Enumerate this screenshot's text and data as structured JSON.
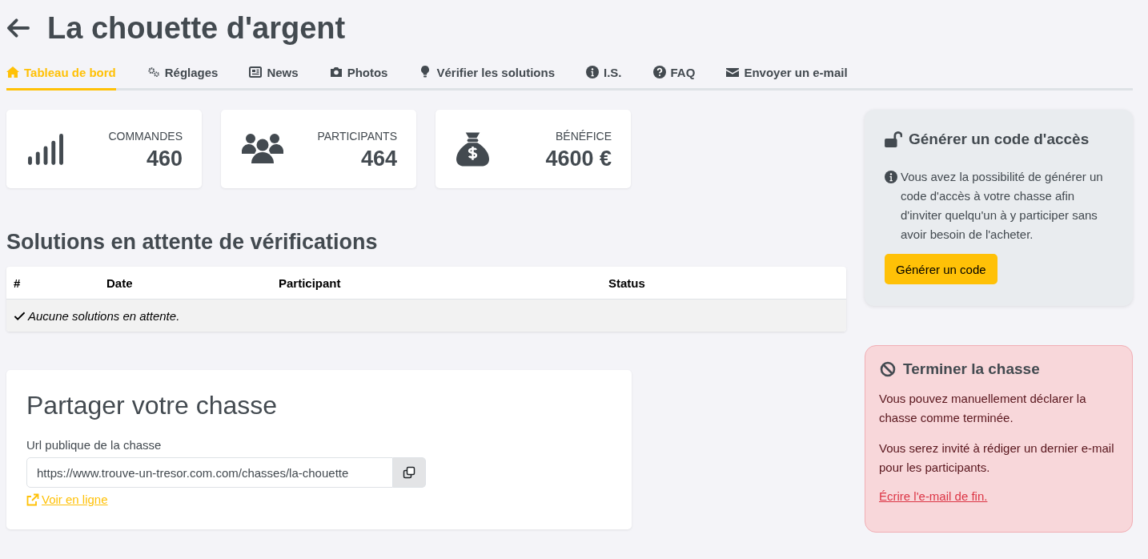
{
  "header": {
    "title": "La chouette d'argent"
  },
  "tabs": [
    {
      "label": "Tableau de bord",
      "selected": true
    },
    {
      "label": "Réglages",
      "selected": false
    },
    {
      "label": "News",
      "selected": false
    },
    {
      "label": "Photos",
      "selected": false
    },
    {
      "label": "Vérifier les solutions",
      "selected": false
    },
    {
      "label": "I.S.",
      "selected": false
    },
    {
      "label": "FAQ",
      "selected": false
    },
    {
      "label": "Envoyer un e-mail",
      "selected": false
    }
  ],
  "stats": [
    {
      "label": "COMMANDES",
      "value": "460"
    },
    {
      "label": "PARTICIPANTS",
      "value": "464"
    },
    {
      "label": "BÉNÉFICE",
      "value": "4600 €"
    }
  ],
  "pending": {
    "title": "Solutions en attente de vérifications",
    "table": {
      "columns": [
        "#",
        "Date",
        "Participant",
        "Status"
      ],
      "empty_message": "Aucune solutions en attente."
    }
  },
  "share": {
    "title": "Partager votre chasse",
    "field_label": "Url publique de la chasse",
    "url": "https://www.trouve-un-tresor.com.com/chasses/la-chouette",
    "link": "Voir en ligne"
  },
  "access_card": {
    "title": "Générer un code d'accès",
    "text": "Vous avez la possibilité de générer un code d'accès à votre chasse afin d'inviter quelqu'un à y participer sans avoir besoin de l'acheter.",
    "button": "Générer un code"
  },
  "end_card": {
    "title": "Terminer la chasse",
    "paragraphs": [
      "Vous pouvez manuellement déclarer la chasse comme terminée.",
      "Vous serez invité à rédiger un dernier e-mail pour les participants."
    ],
    "link": "Écrire l'e-mail de fin."
  }
}
